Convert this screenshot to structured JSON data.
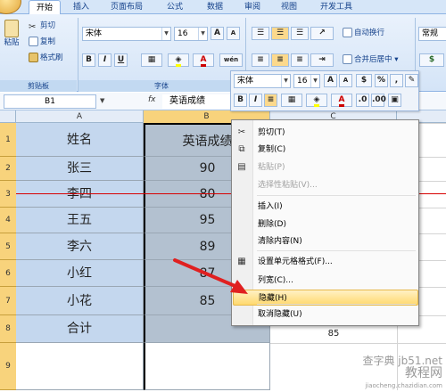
{
  "ribbon": {
    "tabs": [
      "开始",
      "插入",
      "页面布局",
      "公式",
      "数据",
      "审阅",
      "视图",
      "开发工具"
    ],
    "clipboard": {
      "paste": "粘贴",
      "cut": "剪切",
      "copy": "复制",
      "format_painter": "格式刷",
      "group_label": "剪贴板"
    },
    "font": {
      "name": "宋体",
      "size": "16",
      "grow": "A",
      "shrink": "A",
      "bold": "B",
      "italic": "I",
      "underline": "U",
      "phonetic": "wén",
      "group_label": "字体"
    },
    "alignment": {
      "wrap": "自动换行",
      "merge": "合并后居中"
    },
    "number": {
      "format": "常规"
    }
  },
  "formula_bar": {
    "name_box": "B1",
    "fx": "fx",
    "value": "英语成绩"
  },
  "columns": [
    "A",
    "B",
    "C"
  ],
  "rows": [
    "1",
    "2",
    "3",
    "4",
    "5",
    "6",
    "7",
    "8",
    "9"
  ],
  "sheet": {
    "colA": [
      "姓名",
      "张三",
      "李四",
      "王五",
      "李六",
      "小红",
      "小花",
      "合计",
      ""
    ],
    "colB": [
      "英语成绩",
      "90",
      "80",
      "95",
      "89",
      "87",
      "85",
      "",
      ""
    ],
    "c8": "85"
  },
  "mini_toolbar": {
    "font": "宋体",
    "size": "16",
    "percent": "%",
    "comma": ",",
    "bold": "B",
    "italic": "I"
  },
  "context_menu": {
    "items": [
      {
        "label": "剪切(T)",
        "icon": "scissors-icon",
        "disabled": false
      },
      {
        "label": "复制(C)",
        "icon": "copy-icon",
        "disabled": false
      },
      {
        "label": "粘贴(P)",
        "icon": "paste-icon",
        "disabled": true
      },
      {
        "label": "选择性粘贴(V)...",
        "icon": "",
        "disabled": true
      },
      {
        "label": "插入(I)",
        "icon": "",
        "disabled": false
      },
      {
        "label": "删除(D)",
        "icon": "",
        "disabled": false
      },
      {
        "label": "清除内容(N)",
        "icon": "",
        "disabled": false
      },
      {
        "label": "设置单元格格式(F)...",
        "icon": "format-cells-icon",
        "disabled": false
      },
      {
        "label": "列宽(C)...",
        "icon": "",
        "disabled": false
      },
      {
        "label": "隐藏(H)",
        "icon": "",
        "disabled": false,
        "highlighted": true
      },
      {
        "label": "取消隐藏(U)",
        "icon": "",
        "disabled": false
      }
    ]
  },
  "watermark": {
    "line1": "查字典 jb51.net",
    "line2": "教程网",
    "line3": "jiaocheng.chazidian.com"
  },
  "colors": {
    "accent": "#d80000",
    "selection": "#b3c1d0",
    "highlight": "#ffd96e"
  }
}
